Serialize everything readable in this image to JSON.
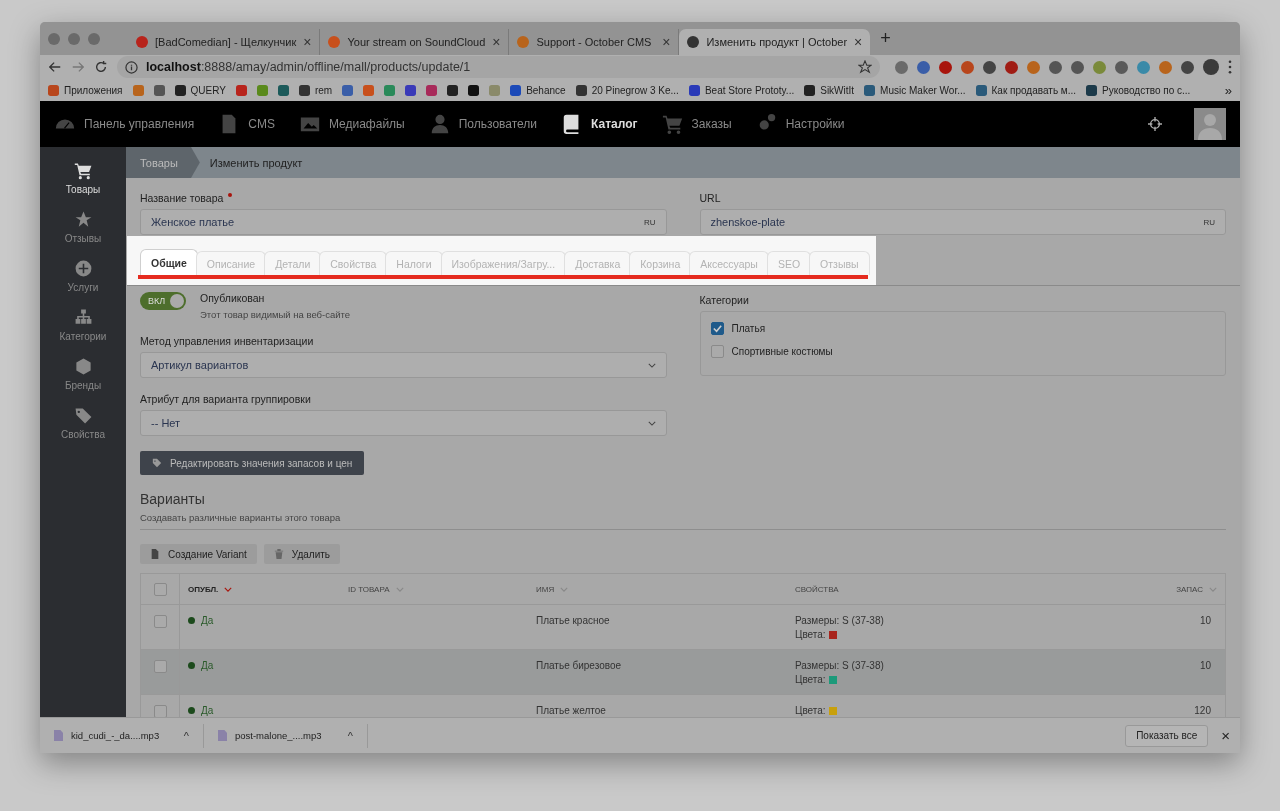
{
  "browser": {
    "tabs": [
      {
        "title": "[BadComedian] - Щелкунчик",
        "close": "×",
        "color": "#b8241c",
        "selected": false
      },
      {
        "title": "Your stream on SoundCloud",
        "close": "×",
        "color": "#c8501c",
        "selected": false
      },
      {
        "title": "Support - October CMS",
        "close": "×",
        "color": "#b8641c",
        "selected": false
      },
      {
        "title": "Изменить продукт | October",
        "close": "×",
        "color": "#333333",
        "selected": true
      }
    ],
    "new_tab": "+",
    "address": {
      "host": "localhost",
      "path": ":8888/amay/admin/offline/mall/products/update/1"
    },
    "extensions": [
      {
        "color": "#6a6a6a"
      },
      {
        "color": "#3a5ea8"
      },
      {
        "color": "#a8140c"
      },
      {
        "color": "#b8461c"
      },
      {
        "color": "#444444"
      },
      {
        "color": "#a01c14"
      },
      {
        "color": "#b8641c"
      },
      {
        "color": "#555555"
      },
      {
        "color": "#555555"
      },
      {
        "color": "#7a8a3a"
      },
      {
        "color": "#5a5a5a"
      },
      {
        "color": "#3a8aa8"
      },
      {
        "color": "#b8641c"
      },
      {
        "color": "#444444"
      }
    ],
    "bookmarks": [
      {
        "label": "Приложения",
        "color": "#b8461c"
      },
      {
        "color": "#b8641c"
      },
      {
        "color": "#555555"
      },
      {
        "label": "QUERY",
        "color": "#222222"
      },
      {
        "color": "#b8241c"
      },
      {
        "color": "#5a8a1c"
      },
      {
        "color": "#1c5a5a"
      },
      {
        "label": "rem",
        "color": "#333333"
      },
      {
        "color": "#3a5ea8"
      },
      {
        "color": "#c8501c"
      },
      {
        "color": "#2a8a5a"
      },
      {
        "color": "#3a3ab8"
      },
      {
        "color": "#a82a5a"
      },
      {
        "color": "#222222"
      },
      {
        "color": "#111111"
      },
      {
        "color": "#8a8a6a"
      },
      {
        "label": "Behance",
        "color": "#1c4ab8"
      },
      {
        "label": "20 Pinegrow 3 Ke...",
        "color": "#333333"
      },
      {
        "label": "Beat Store Prototy...",
        "color": "#2a3ab8"
      },
      {
        "label": "SikWitIt",
        "color": "#222222"
      },
      {
        "label": "Music Maker Wor...",
        "color": "#2a5a7a"
      },
      {
        "label": "Как продавать м...",
        "color": "#2a5a7a"
      },
      {
        "label": "Руководство по с...",
        "color": "#1c3a4a"
      }
    ],
    "bookmarks_more": "»"
  },
  "nav": [
    {
      "label": "Панель управления",
      "selected": false
    },
    {
      "label": "CMS",
      "selected": false
    },
    {
      "label": "Медиафайлы",
      "selected": false
    },
    {
      "label": "Пользователи",
      "selected": false
    },
    {
      "label": "Каталог",
      "selected": true
    },
    {
      "label": "Заказы",
      "selected": false
    },
    {
      "label": "Настройки",
      "selected": false
    }
  ],
  "sidebar": [
    {
      "label": "Товары",
      "selected": true
    },
    {
      "label": "Отзывы",
      "selected": false
    },
    {
      "label": "Услуги",
      "selected": false
    },
    {
      "label": "Категории",
      "selected": false
    },
    {
      "label": "Бренды",
      "selected": false
    },
    {
      "label": "Свойства",
      "selected": false
    }
  ],
  "breadcrumb": [
    "Товары",
    "Изменить продукт"
  ],
  "fields": [
    {
      "label": "Название товара",
      "required": true,
      "value": "Женское платье",
      "locale": "RU"
    },
    {
      "label": "URL",
      "required": false,
      "value": "zhenskoe-plate",
      "locale": "RU"
    }
  ],
  "form_tabs": [
    {
      "label": "Общие",
      "selected": true
    },
    {
      "label": "Описание",
      "selected": false
    },
    {
      "label": "Детали",
      "selected": false
    },
    {
      "label": "Свойства",
      "selected": false
    },
    {
      "label": "Налоги",
      "selected": false
    },
    {
      "label": "Изображения/Загру...",
      "selected": false
    },
    {
      "label": "Доставка",
      "selected": false
    },
    {
      "label": "Корзина",
      "selected": false
    },
    {
      "label": "Аксессуары",
      "selected": false
    },
    {
      "label": "SEO",
      "selected": false
    },
    {
      "label": "Отзывы",
      "selected": false
    }
  ],
  "published": {
    "switch_label": "ВКЛ",
    "on": true,
    "label": "Опубликован",
    "comment": "Этот товар видимый на веб-сайте"
  },
  "selects": [
    {
      "label": "Метод управления инвентаризации",
      "value": "Артикул вариантов"
    },
    {
      "label": "Атрибут для варианта группировки",
      "value": "-- Нет"
    }
  ],
  "edit_button": "Редактировать значения запасов и цен",
  "categories": {
    "label": "Категории",
    "items": [
      {
        "label": "Платья",
        "checked": true
      },
      {
        "label": "Спортивные костюмы",
        "checked": false
      }
    ]
  },
  "variants": {
    "title": "Варианты",
    "comment": "Создавать различные варианты этого товара",
    "buttons": [
      "Создание Variant",
      "Удалить"
    ],
    "select_all_checked": false,
    "columns": [
      {
        "label": "ОПУБЛ.",
        "sortable": true,
        "sorted": true
      },
      {
        "label": "ID ТОВАРА",
        "sortable": true,
        "sorted": false
      },
      {
        "label": "ИМЯ",
        "sortable": true,
        "sorted": false
      },
      {
        "label": "СВОЙСТВА",
        "sortable": false,
        "sorted": false
      },
      {
        "label": "ЗАПАС",
        "sortable": true,
        "sorted": false
      }
    ],
    "rows": [
      {
        "published": "Да",
        "name": "Платье красное",
        "sizes": "Размеры: S (37-38)",
        "colors_label": "Цвета:",
        "color": "#a8241c",
        "stock": "10",
        "checked": false,
        "selected": false
      },
      {
        "published": "Да",
        "name": "Платье бирезовое",
        "sizes": "Размеры: S (37-38)",
        "colors_label": "Цвета:",
        "color": "#1c9a7a",
        "stock": "10",
        "checked": false,
        "selected": true
      },
      {
        "published": "Да",
        "name": "Платье желтое",
        "colors_label": "Цвета:",
        "color": "#c8a00c",
        "stock": "120",
        "checked": false,
        "selected": false
      }
    ]
  },
  "downloads": {
    "items": [
      {
        "name": "kid_cudi_-_da....mp3",
        "caret": "^"
      },
      {
        "name": "post-malone_....mp3",
        "caret": "^"
      }
    ],
    "show_all": "Показать все",
    "close": "×"
  }
}
